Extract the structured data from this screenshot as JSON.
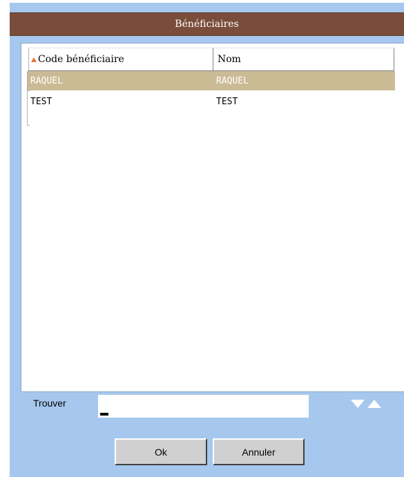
{
  "dialog": {
    "title": "Bénéficiaires"
  },
  "table": {
    "columns": [
      {
        "label": "Code bénéficiaire",
        "sorted": "ascending"
      },
      {
        "label": "Nom"
      }
    ],
    "rows": [
      {
        "code": "RAQUEL",
        "nom": "RAQUEL",
        "selected": true
      },
      {
        "code": "TEST",
        "nom": "TEST",
        "selected": false
      }
    ]
  },
  "find": {
    "label": "Trouver",
    "value": ""
  },
  "buttons": {
    "ok_label": "Ok",
    "cancel_label": "Annuler"
  },
  "icons": {
    "sort": "sort-ascending-icon",
    "next": "arrow-down-icon",
    "previous": "arrow-up-icon"
  },
  "colors": {
    "title_bar": "#7a4d3a",
    "dialog_background": "#a6c8ee",
    "selected_row": "#cbbb95",
    "sort_indicator": "#e0783a"
  }
}
